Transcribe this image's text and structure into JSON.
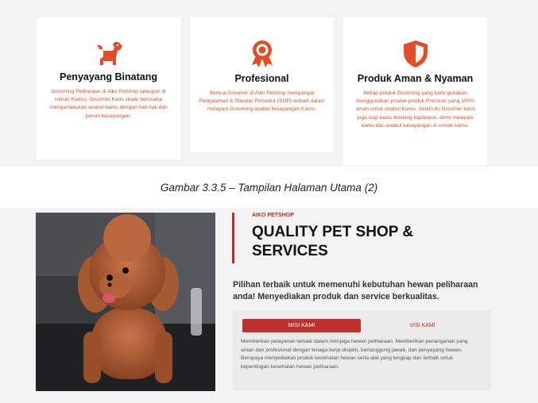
{
  "colors": {
    "accent": "#e34d27",
    "brand": "#b92d2a",
    "tab_active": "#c0312e"
  },
  "features": [
    {
      "icon": "dog-icon",
      "title": "Penyayang Binatang",
      "text": "Grooming Peliharaan di Aiko Petshop (ataupun di rumah Kamu), Groomer Kami selalu berusaha memperlakukan anabul kamu dengan hati-hati dan penuh kesayangan."
    },
    {
      "icon": "award-ribbon-icon",
      "title": "Profesional",
      "text": "Semua Groomer di Aiko Petshop mempunyai Pengalaman & Standar Prosedur (SOP) terbaik dalam melayani Grooming anabul kesayangan Kamu."
    },
    {
      "icon": "shield-icon",
      "title": "Produk Aman & Nyaman",
      "text": "Setiap produk Grooming yang kami gunakan menggunakan produk-produk Premium yang 100% aman untuk anabul Kamu. Selain itu Groomer kami juga siap kamu booking kapanpun, demi melayani kamu dan anabul kesayangan di rumah kamu."
    }
  ],
  "caption": "Gambar 3.3.5 – Tampilan Halaman Utama (2)",
  "about": {
    "eyebrow": "AIKO PETSHOP",
    "headline": "QUALITY PET SHOP & SERVICES",
    "lead": "Pilihan terbaik untuk memenuhi kebutuhan hewan peliharaan anda! Menyediakan produk dan service berkualitas.",
    "tabs": [
      {
        "label": "MISI KAMI",
        "active": true
      },
      {
        "label": "VISI KAMI",
        "active": false
      }
    ],
    "tab_content": "Memberikan pelayanan terbaik dalam menjaga hewan peliharaan. Memberikan penanganan yang aman dan profesional dengan tenaga kerja disiplin, bertanggung jawab, dan penyayang hewan. Berupaya menyediakan produk kesehatan hewan serta alat yang lengkap dan terbaik untuk kepentingan kesehatan hewan peliharaan."
  }
}
